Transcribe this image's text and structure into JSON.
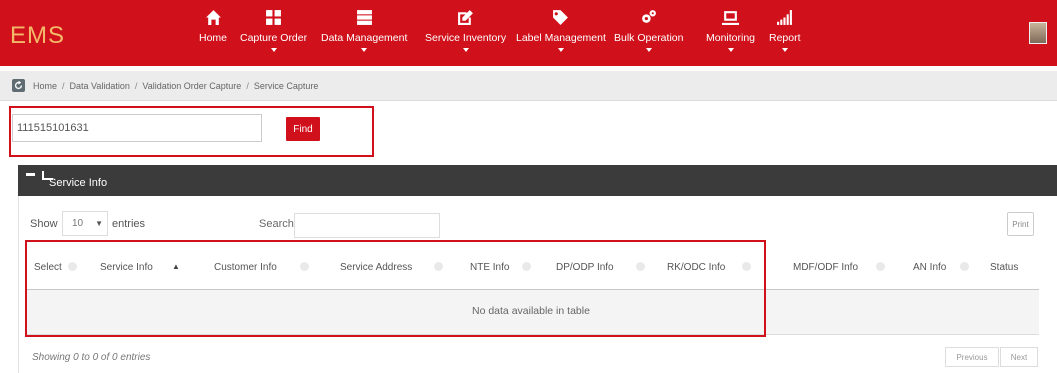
{
  "app": {
    "logo": "EMS",
    "brand_color": "#d0111b"
  },
  "nav": [
    {
      "label": "Home",
      "icon": "home-icon",
      "dropdown": false
    },
    {
      "label": "Capture Order",
      "icon": "grid-icon",
      "dropdown": true
    },
    {
      "label": "Data Management",
      "icon": "server-icon",
      "dropdown": true
    },
    {
      "label": "Service Inventory",
      "icon": "edit-icon",
      "dropdown": true
    },
    {
      "label": "Label Management",
      "icon": "tag-icon",
      "dropdown": true
    },
    {
      "label": "Bulk Operation",
      "icon": "cogs-icon",
      "dropdown": true
    },
    {
      "label": "Monitoring",
      "icon": "monitor-icon",
      "dropdown": true
    },
    {
      "label": "Report",
      "icon": "bar-chart-icon",
      "dropdown": true
    }
  ],
  "breadcrumb": [
    "Home",
    "Data Validation",
    "Validation Order Capture",
    "Service Capture"
  ],
  "search": {
    "value": "111515101631",
    "find_label": "Find"
  },
  "panel": {
    "title": "Service Info"
  },
  "table_controls": {
    "show_label": "Show",
    "page_length": "10",
    "entries_label": "entries",
    "search_label": "Search:",
    "print_label": "Print"
  },
  "table": {
    "columns": [
      "Select",
      "Service Info",
      "Customer Info",
      "Service Address",
      "NTE Info",
      "DP/ODP Info",
      "RK/ODC Info",
      "MDF/ODF Info",
      "AN Info",
      "Status"
    ],
    "empty_text": "No data available in table"
  },
  "footer": {
    "info": "Showing 0 to 0 of 0 entries",
    "previous_label": "Previous",
    "next_label": "Next"
  }
}
